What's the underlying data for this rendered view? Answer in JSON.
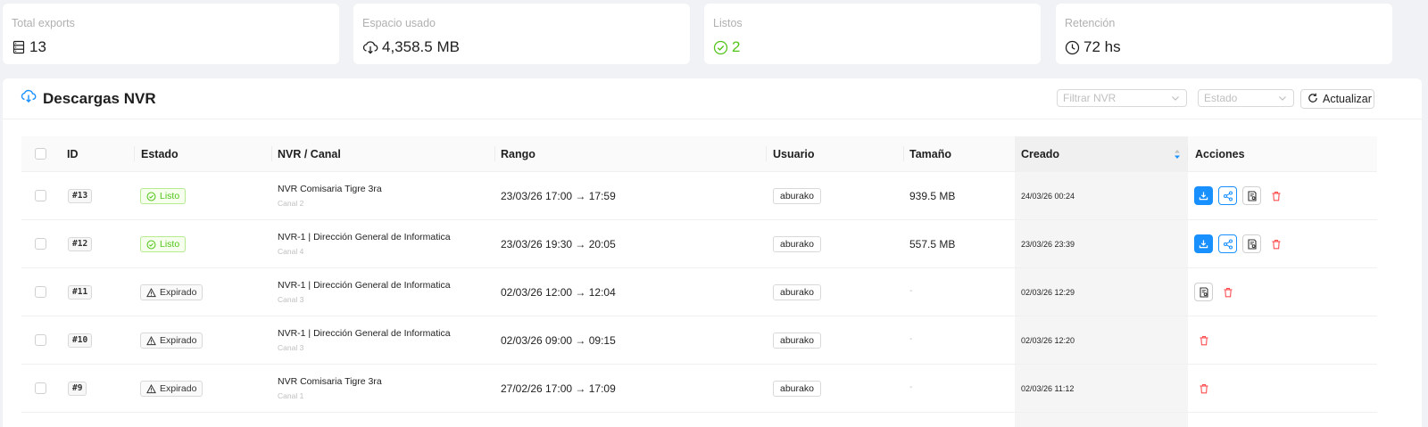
{
  "stats": [
    {
      "label": "Total exports",
      "value": "13",
      "icon": "database-icon"
    },
    {
      "label": "Espacio usado",
      "value": "4,358.5 MB",
      "icon": "cloud-download-icon"
    },
    {
      "label": "Listos",
      "value": "2",
      "icon": "check-circle-icon",
      "color": "#52c41a"
    },
    {
      "label": "Retención",
      "value": "72 hs",
      "icon": "clock-icon"
    }
  ],
  "header": {
    "title": "Descargas NVR",
    "filter_nvr_placeholder": "Filtrar NVR",
    "filter_estado_placeholder": "Estado",
    "refresh_label": "Actualizar"
  },
  "table": {
    "columns": [
      "ID",
      "Estado",
      "NVR / Canal",
      "Rango",
      "Usuario",
      "Tamaño",
      "Creado",
      "Acciones"
    ],
    "sorted_column": "Creado",
    "sort_direction": "descending",
    "rows": [
      {
        "id": "#13",
        "status": "Listo",
        "nvr": "NVR Comisaria Tigre 3ra",
        "channel": "Canal 2",
        "range": "23/03/26 17:00 → 17:59",
        "user": "aburako",
        "size": "939.5 MB",
        "created": "24/03/26 00:24",
        "actions": [
          "download",
          "share",
          "report",
          "delete"
        ]
      },
      {
        "id": "#12",
        "status": "Listo",
        "nvr": "NVR-1 | Dirección General de Informatica",
        "channel": "Canal 4",
        "range": "23/03/26 19:30 → 20:05",
        "user": "aburako",
        "size": "557.5 MB",
        "created": "23/03/26 23:39",
        "actions": [
          "download",
          "share",
          "report",
          "delete"
        ]
      },
      {
        "id": "#11",
        "status": "Expirado",
        "nvr": "NVR-1 | Dirección General de Informatica",
        "channel": "Canal 3",
        "range": "02/03/26 12:00 → 12:04",
        "user": "aburako",
        "size": "-",
        "created": "02/03/26 12:29",
        "actions": [
          "report",
          "delete"
        ]
      },
      {
        "id": "#10",
        "status": "Expirado",
        "nvr": "NVR-1 | Dirección General de Informatica",
        "channel": "Canal 3",
        "range": "02/03/26 09:00 → 09:15",
        "user": "aburako",
        "size": "-",
        "created": "02/03/26 12:20",
        "actions": [
          "delete"
        ]
      },
      {
        "id": "#9",
        "status": "Expirado",
        "nvr": "NVR Comisaria Tigre 3ra",
        "channel": "Canal 1",
        "range": "27/02/26 17:00 → 17:09",
        "user": "aburako",
        "size": "-",
        "created": "02/03/26 11:12",
        "actions": [
          "delete"
        ]
      }
    ]
  },
  "colors": {
    "primary": "#1890ff",
    "success": "#52c41a",
    "danger": "#ff4d4f"
  }
}
